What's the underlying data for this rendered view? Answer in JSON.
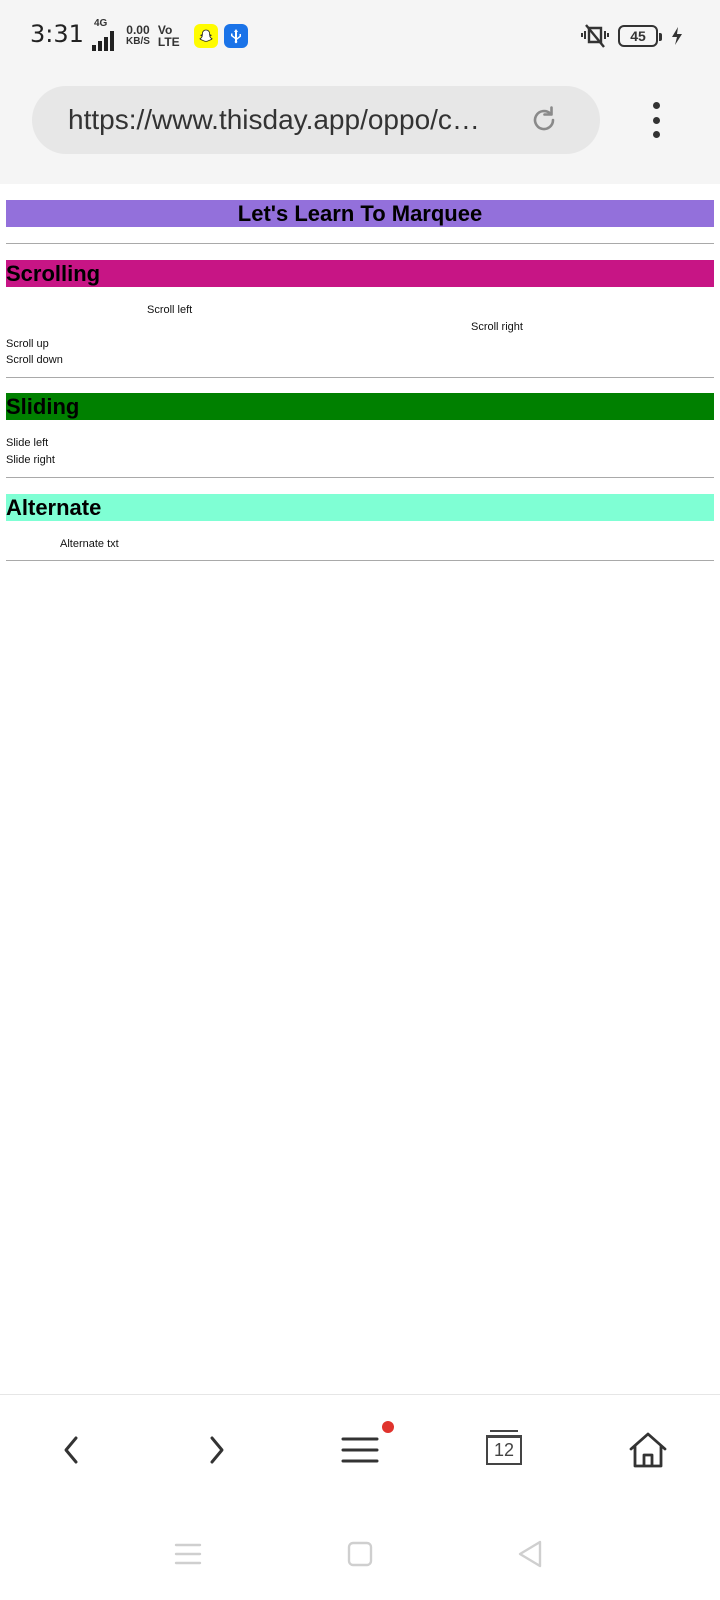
{
  "status_bar": {
    "time": "3:31",
    "network_type": "4G",
    "speed_value": "0.00",
    "speed_unit": "KB/S",
    "volte_top": "Vo",
    "volte_bottom": "LTE",
    "battery": "45",
    "snapchat_icon": "snapchat-icon",
    "usb_icon": "usb-icon",
    "silent_icon": "vibrate-off-icon",
    "charging_icon": "charging-icon"
  },
  "browser": {
    "url": "https://www.thisday.app/oppo/c…",
    "reload_icon": "reload-icon",
    "menu_icon": "more-vert-icon"
  },
  "page": {
    "title": "Let's Learn To Marquee",
    "scrolling": {
      "heading": "Scrolling",
      "scroll_left": "Scroll left",
      "scroll_right": "Scroll right",
      "scroll_up": "Scroll up",
      "scroll_down": "Scroll down"
    },
    "sliding": {
      "heading": "Sliding",
      "slide_left": "Slide left",
      "slide_right": "Slide right"
    },
    "alternate": {
      "heading": "Alternate",
      "alternate_text": "Alternate txt"
    }
  },
  "colors": {
    "title_bg": "#9370db",
    "scrolling_bg": "#c71585",
    "sliding_bg": "#008000",
    "alternate_bg": "#7fffd4",
    "notification_dot": "#e0332d"
  },
  "navbar": {
    "back_icon": "chevron-left-icon",
    "forward_icon": "chevron-right-icon",
    "menu_icon": "hamburger-menu-icon",
    "tabs_count": "12",
    "home_icon": "home-icon"
  },
  "system_nav": {
    "recents_icon": "recents-icon",
    "home_icon": "square-home-icon",
    "back_icon": "triangle-back-icon"
  }
}
